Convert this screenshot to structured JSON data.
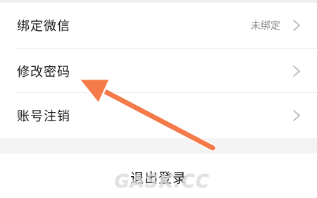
{
  "settings": {
    "rows": [
      {
        "label": "绑定微信",
        "value": "未绑定"
      },
      {
        "label": "修改密码",
        "value": ""
      },
      {
        "label": "账号注销",
        "value": ""
      }
    ],
    "logout_label": "退出登录"
  },
  "watermark": {
    "text": "GASK.CC"
  },
  "colors": {
    "arrow": "#f47a4a",
    "arrow_outline": "#ffffff",
    "separator": "#ececec",
    "section_gap": "#f3f3f3"
  },
  "icons": {
    "row_chevron": "chevron-right-icon",
    "annotation": "arrow-annotation"
  }
}
